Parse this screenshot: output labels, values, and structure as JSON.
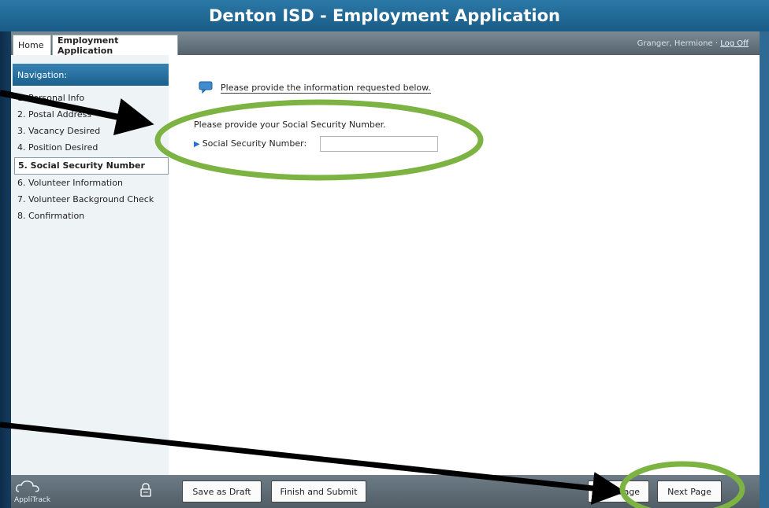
{
  "window": {
    "title": "Denton ISD - Employment Application"
  },
  "tabs": [
    {
      "label": "Home"
    },
    {
      "label": "Employment Application"
    }
  ],
  "user": {
    "name": "Granger, Hermione",
    "separator": " · ",
    "logoff": "Log Off"
  },
  "navigation": {
    "heading": "Navigation:",
    "items": [
      {
        "label": "1. Personal Info"
      },
      {
        "label": "2. Postal Address"
      },
      {
        "label": "3. Vacancy Desired"
      },
      {
        "label": "4. Position Desired"
      },
      {
        "label": "5. Social Security Number",
        "active": true
      },
      {
        "label": "6. Volunteer Information"
      },
      {
        "label": "7. Volunteer Background Check"
      },
      {
        "label": "8. Confirmation"
      }
    ]
  },
  "main": {
    "info_message": "Please provide the information requested below.",
    "prompt": "Please provide your Social Security Number.",
    "ssn_label": "Social Security Number:",
    "ssn_value": ""
  },
  "footer": {
    "brand": "AppliTrack",
    "save_draft": "Save as Draft",
    "finish_submit": "Finish and Submit",
    "prev_page": "Prev Page",
    "next_page": "Next Page"
  },
  "colors": {
    "title_bar": "#1f6794",
    "nav_heading": "#2a73a3",
    "annotation_circle": "#7cb342",
    "annotation_arrow": "#000000"
  },
  "icons": [
    "speech-bubble-icon",
    "blue-triangle-icon",
    "lock-icon",
    "applitrack-cloud-logo"
  ]
}
